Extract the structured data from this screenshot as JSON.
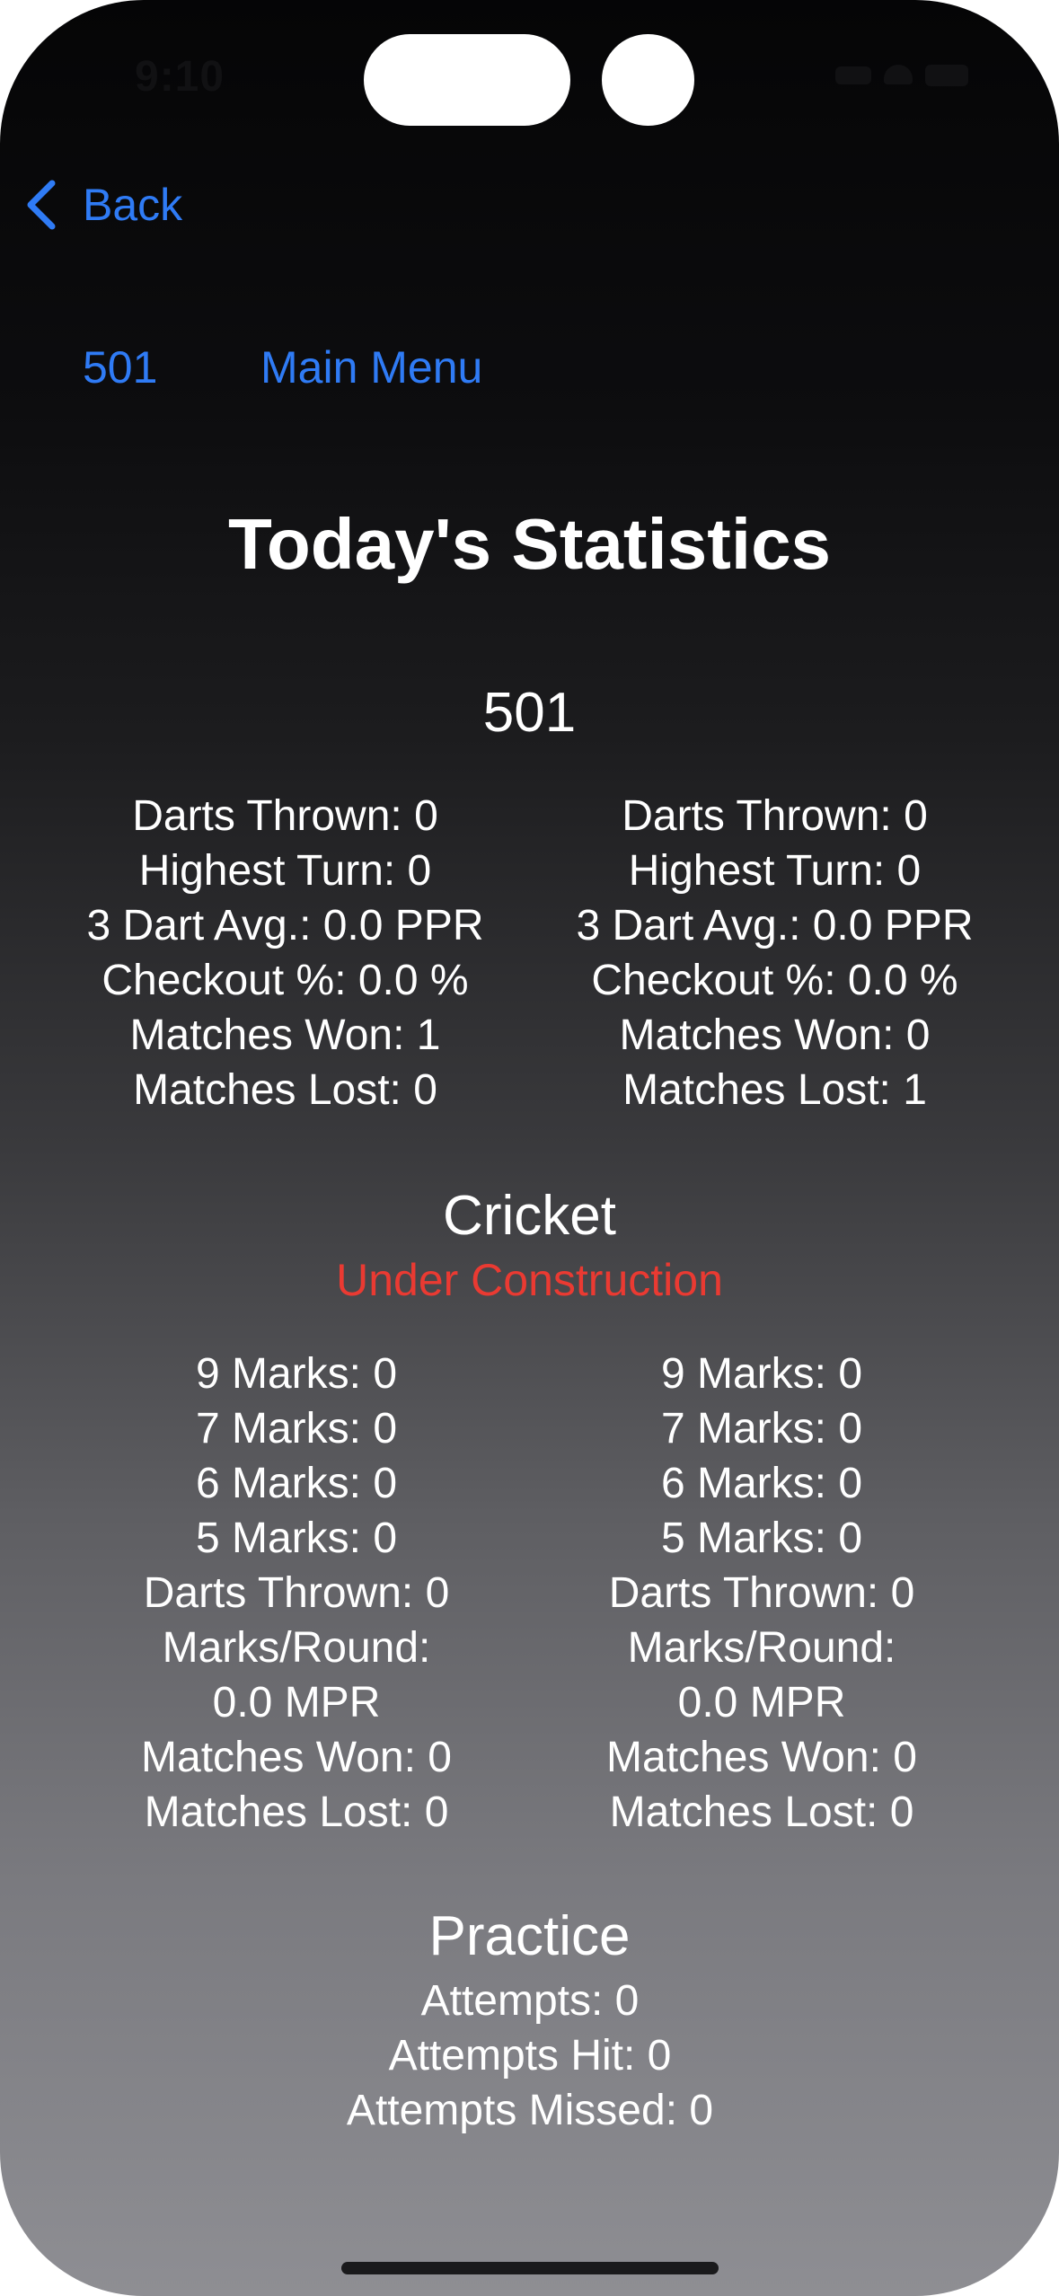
{
  "status_bar": {
    "time": "9:10"
  },
  "nav": {
    "back_label": "Back",
    "links": [
      "501",
      "Main Menu"
    ]
  },
  "page_title": "Today's Statistics",
  "x01": {
    "heading": "501",
    "players": [
      {
        "stats": [
          "Darts Thrown: 0",
          "Highest Turn: 0",
          "3 Dart Avg.: 0.0 PPR",
          "Checkout %: 0.0 %",
          "Matches Won: 1",
          "Matches Lost: 0"
        ]
      },
      {
        "stats": [
          "Darts Thrown: 0",
          "Highest Turn: 0",
          "3 Dart Avg.: 0.0 PPR",
          "Checkout %: 0.0 %",
          "Matches Won: 0",
          "Matches Lost: 1"
        ]
      }
    ]
  },
  "cricket": {
    "heading": "Cricket",
    "note": "Under Construction",
    "players": [
      {
        "stats": [
          "9 Marks: 0",
          "7 Marks: 0",
          "6 Marks: 0",
          "5 Marks: 0",
          "Darts Thrown: 0",
          "Marks/Round:",
          "0.0 MPR",
          "Matches Won: 0",
          "Matches Lost: 0"
        ]
      },
      {
        "stats": [
          "9 Marks: 0",
          "7 Marks: 0",
          "6 Marks: 0",
          "5 Marks: 0",
          "Darts Thrown: 0",
          "Marks/Round:",
          "0.0 MPR",
          "Matches Won: 0",
          "Matches Lost: 0"
        ]
      }
    ]
  },
  "practice": {
    "heading": "Practice",
    "stats": [
      "Attempts: 0",
      "Attempts Hit: 0",
      "Attempts Missed: 0"
    ]
  },
  "colors": {
    "link": "#2f7bf5",
    "warning": "#ea3a32",
    "text": "#ffffff"
  }
}
